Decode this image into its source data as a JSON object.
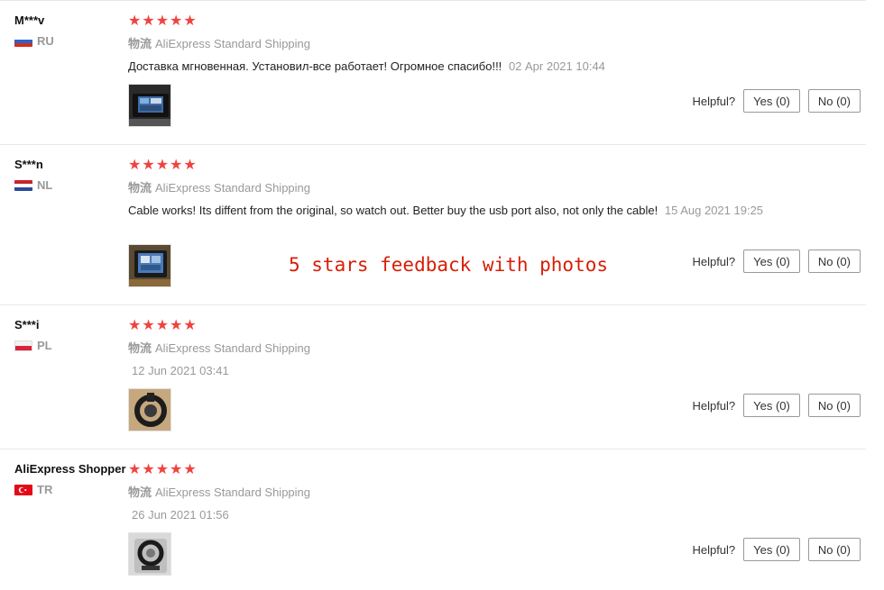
{
  "watermark": "5 stars feedback with photos",
  "stars_glyph": "★★★★★",
  "shipping_label": "物流",
  "shipping_method": "AliExpress Standard Shipping",
  "helpful_label": "Helpful?",
  "reviews": [
    {
      "user": "M***v",
      "country": "RU",
      "rating": 5,
      "text": "Доставка мгновенная. Установил-все работает! Огромное спасибо!!!",
      "date": "02 Apr 2021 10:44",
      "yes": "Yes (0)",
      "no": "No (0)"
    },
    {
      "user": "S***n",
      "country": "NL",
      "rating": 5,
      "text": "Cable works! Its diffent from the original, so watch out. Better buy the usb port also, not only the cable!",
      "date": "15 Aug 2021 19:25",
      "yes": "Yes (0)",
      "no": "No (0)"
    },
    {
      "user": "S***i",
      "country": "PL",
      "rating": 5,
      "text": "",
      "date": "12 Jun 2021 03:41",
      "yes": "Yes (0)",
      "no": "No (0)"
    },
    {
      "user": "AliExpress Shopper",
      "country": "TR",
      "rating": 5,
      "text": "",
      "date": "26 Jun 2021 01:56",
      "yes": "Yes (0)",
      "no": "No (0)"
    }
  ]
}
